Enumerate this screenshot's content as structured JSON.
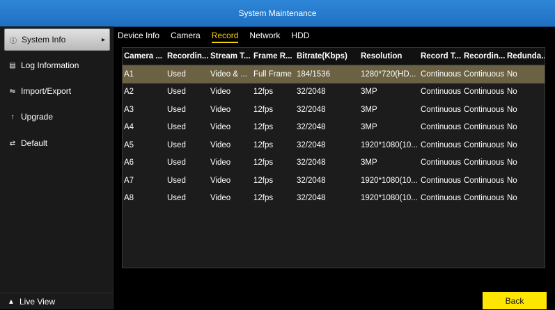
{
  "window": {
    "title": "System Maintenance"
  },
  "sidebar": {
    "items": [
      {
        "label": "System Info",
        "icon": "info-icon",
        "active": true
      },
      {
        "label": "Log Information",
        "icon": "log-icon",
        "active": false
      },
      {
        "label": "Import/Export",
        "icon": "import-export-icon",
        "active": false
      },
      {
        "label": "Upgrade",
        "icon": "upgrade-icon",
        "active": false
      },
      {
        "label": "Default",
        "icon": "default-icon",
        "active": false
      }
    ],
    "live_view": "Live View"
  },
  "tabs": [
    {
      "label": "Device Info",
      "active": false
    },
    {
      "label": "Camera",
      "active": false
    },
    {
      "label": "Record",
      "active": true
    },
    {
      "label": "Network",
      "active": false
    },
    {
      "label": "HDD",
      "active": false
    }
  ],
  "table": {
    "columns": [
      "Camera ...",
      "Recordin...",
      "Stream T...",
      "Frame R...",
      "Bitrate(Kbps)",
      "Resolution",
      "Record T...",
      "Recordin...",
      "Redunda..."
    ],
    "rows": [
      [
        "A1",
        "Used",
        "Video & ...",
        "Full Frame",
        "184/1536",
        "1280*720(HD...",
        "Continuous",
        "Continuous",
        "No"
      ],
      [
        "A2",
        "Used",
        "Video",
        "12fps",
        "32/2048",
        "3MP",
        "Continuous",
        "Continuous",
        "No"
      ],
      [
        "A3",
        "Used",
        "Video",
        "12fps",
        "32/2048",
        "3MP",
        "Continuous",
        "Continuous",
        "No"
      ],
      [
        "A4",
        "Used",
        "Video",
        "12fps",
        "32/2048",
        "3MP",
        "Continuous",
        "Continuous",
        "No"
      ],
      [
        "A5",
        "Used",
        "Video",
        "12fps",
        "32/2048",
        "1920*1080(10...",
        "Continuous",
        "Continuous",
        "No"
      ],
      [
        "A6",
        "Used",
        "Video",
        "12fps",
        "32/2048",
        "3MP",
        "Continuous",
        "Continuous",
        "No"
      ],
      [
        "A7",
        "Used",
        "Video",
        "12fps",
        "32/2048",
        "1920*1080(10...",
        "Continuous",
        "Continuous",
        "No"
      ],
      [
        "A8",
        "Used",
        "Video",
        "12fps",
        "32/2048",
        "1920*1080(10...",
        "Continuous",
        "Continuous",
        "No"
      ]
    ],
    "selected_row": 0
  },
  "buttons": {
    "back": "Back"
  },
  "colors": {
    "accent": "#f5d000",
    "titlebar": "#2a7fd0",
    "selected_row": "#6b6243",
    "button": "#ffe600"
  }
}
